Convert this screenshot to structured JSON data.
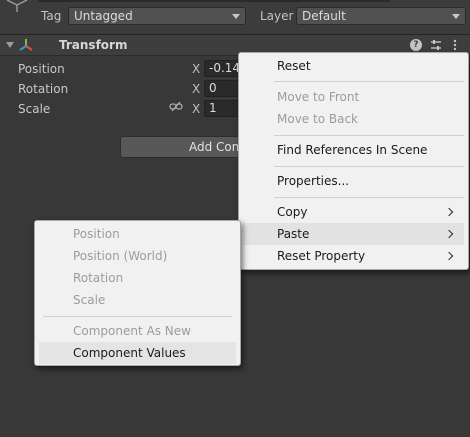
{
  "header": {
    "tag_label": "Tag",
    "tag_value": "Untagged",
    "layer_label": "Layer",
    "layer_value": "Default"
  },
  "component": {
    "title": "Transform",
    "help_glyph": "?",
    "icons": [
      "transform-icon",
      "help-icon",
      "presets-icon",
      "more-icon"
    ]
  },
  "transform": {
    "rows": [
      {
        "label": "Position",
        "axis": "X",
        "value": "-0.14"
      },
      {
        "label": "Rotation",
        "axis": "X",
        "value": "0"
      },
      {
        "label": "Scale",
        "axis": "X",
        "value": "1"
      }
    ]
  },
  "add_component_label": "Add Component",
  "context_menu": {
    "items": [
      {
        "label": "Reset",
        "enabled": true
      },
      {
        "label": "Move to Front",
        "enabled": false
      },
      {
        "label": "Move to Back",
        "enabled": false
      },
      {
        "label": "Find References In Scene",
        "enabled": true
      },
      {
        "label": "Properties...",
        "enabled": true
      },
      {
        "label": "Copy",
        "enabled": true,
        "submenu": true
      },
      {
        "label": "Paste",
        "enabled": true,
        "submenu": true,
        "highlighted": true
      },
      {
        "label": "Reset Property",
        "enabled": true,
        "submenu": true
      }
    ]
  },
  "paste_submenu": {
    "items": [
      {
        "label": "Position",
        "enabled": false
      },
      {
        "label": "Position (World)",
        "enabled": false
      },
      {
        "label": "Rotation",
        "enabled": false
      },
      {
        "label": "Scale",
        "enabled": false
      },
      {
        "label": "Component As New",
        "enabled": false
      },
      {
        "label": "Component Values",
        "enabled": true,
        "highlighted": true
      }
    ]
  },
  "colors": {
    "background": "#383838",
    "menu_background": "#f1f1f1",
    "disabled_text": "#9c9c9c",
    "transform_icon_red": "#e0503c",
    "transform_icon_green": "#7bc043",
    "transform_icon_blue": "#3d8fe0"
  }
}
